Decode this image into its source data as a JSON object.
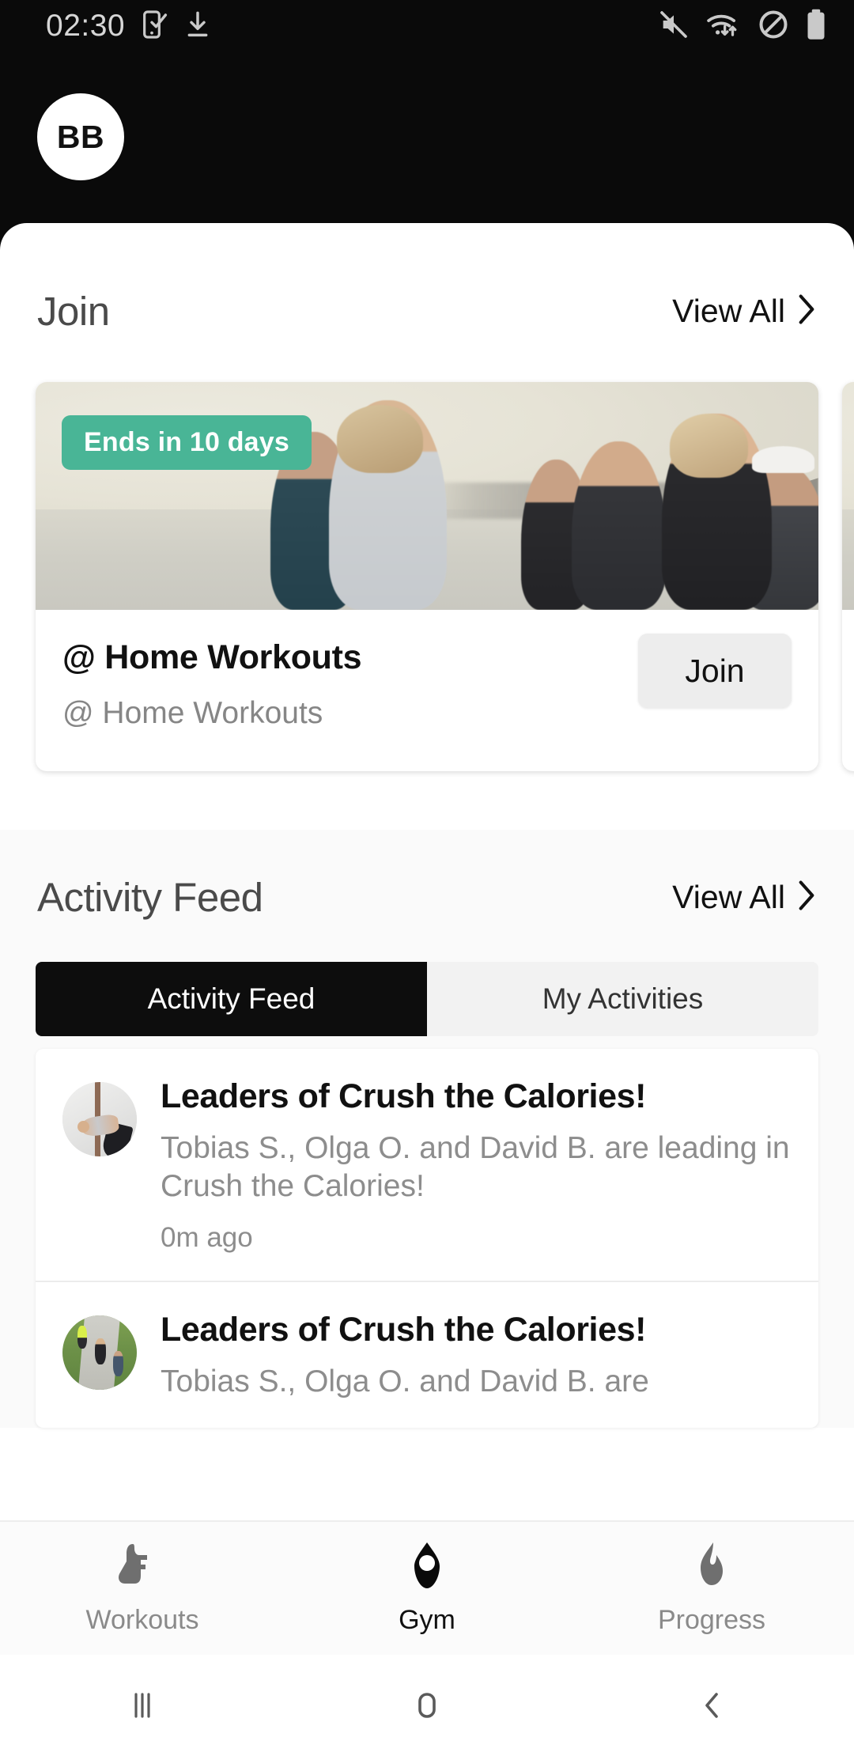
{
  "status_bar": {
    "time": "02:30",
    "left_icons": [
      "phone-check-icon",
      "download-icon"
    ],
    "right_icons": [
      "mute-icon",
      "wifi-transfer-icon",
      "do-not-disturb-icon",
      "battery-icon"
    ]
  },
  "header": {
    "avatar_initials": "BB"
  },
  "join_section": {
    "title": "Join",
    "view_all_label": "View All",
    "cards": [
      {
        "badge": "Ends in 10 days",
        "title": "@ Home Workouts",
        "subtitle": "@ Home Workouts",
        "action_label": "Join",
        "photo": "group-running-beach-photo"
      },
      {
        "badge": "",
        "title": "",
        "subtitle": "",
        "action_label": "",
        "photo": "outdoor-runners-photo"
      }
    ]
  },
  "feed_section": {
    "title": "Activity Feed",
    "view_all_label": "View All",
    "tabs": [
      {
        "label": "Activity Feed",
        "active": true
      },
      {
        "label": "My Activities",
        "active": false
      }
    ],
    "items": [
      {
        "title": "Leaders of Crush the Calories!",
        "description": "Tobias S., Olga O. and David B. are leading in Crush the Calories!",
        "time": "0m ago",
        "avatar": "yoga-stretch-photo"
      },
      {
        "title": "Leaders of Crush the Calories!",
        "description": "Tobias S., Olga O. and David B. are",
        "time": "",
        "avatar": "runners-path-photo"
      }
    ]
  },
  "bottom_nav": {
    "items": [
      {
        "label": "Workouts",
        "icon": "shoe-icon",
        "active": false
      },
      {
        "label": "Gym",
        "icon": "gym-diamond-icon",
        "active": true
      },
      {
        "label": "Progress",
        "icon": "flame-icon",
        "active": false
      }
    ]
  },
  "android_nav": {
    "items": [
      "recents-icon",
      "home-icon",
      "back-icon"
    ]
  },
  "colors": {
    "accent_badge": "#49b596",
    "header_bg": "#0a0a0a",
    "sheet_bg": "#ffffff",
    "tab_active_bg": "#0d0d0d",
    "muted_text": "#8d8d8d"
  }
}
